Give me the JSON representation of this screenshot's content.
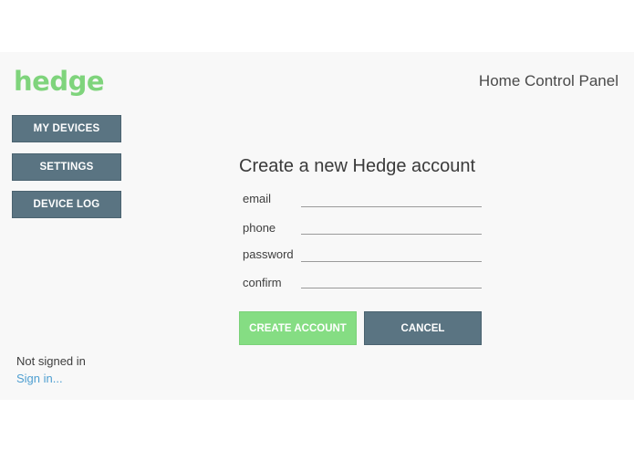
{
  "header": {
    "logo_text": "hedge",
    "app_title": "Home Control Panel"
  },
  "sidebar": {
    "items": [
      {
        "label": "MY DEVICES"
      },
      {
        "label": "SETTINGS"
      },
      {
        "label": "DEVICE LOG"
      }
    ],
    "status_text": "Not signed in",
    "sign_in_link": "Sign in..."
  },
  "form": {
    "title": "Create a new Hedge account",
    "fields": [
      {
        "label": "email",
        "value": ""
      },
      {
        "label": "phone",
        "value": ""
      },
      {
        "label": "password",
        "value": ""
      },
      {
        "label": "confirm",
        "value": ""
      }
    ],
    "create_button": "CREATE ACCOUNT",
    "cancel_button": "CANCEL"
  },
  "colors": {
    "brand_green": "#7fd47c",
    "button_slate": "#5a7482",
    "link_blue": "#4f9fd1",
    "panel_background": "#f8f8f8"
  }
}
